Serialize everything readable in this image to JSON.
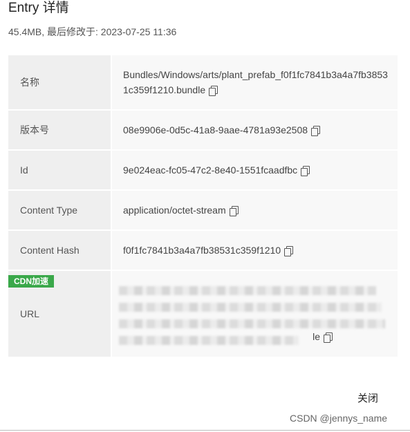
{
  "dialog": {
    "title": "Entry 详情",
    "subtitle": "45.4MB, 最后修改于: 2023-07-25 11:36",
    "close_label": "关闭",
    "watermark": "CSDN @jennys_name"
  },
  "fields": {
    "name": {
      "key": "名称",
      "value": "Bundles/Windows/arts/plant_prefab_f0f1fc7841b3a4a7fb38531c359f1210.bundle"
    },
    "version": {
      "key": "版本号",
      "value": "08e9906e-0d5c-41a8-9aae-4781a93e2508"
    },
    "id": {
      "key": "Id",
      "value": "9e024eac-fc05-47c2-8e40-1551fcaadfbc"
    },
    "content_type": {
      "key": "Content Type",
      "value": "application/octet-stream"
    },
    "content_hash": {
      "key": "Content Hash",
      "value": "f0f1fc7841b3a4a7fb38531c359f1210"
    },
    "url": {
      "key": "URL",
      "badge": "CDN加速",
      "value_tail": "le"
    }
  },
  "icons": {
    "copy": "copy-icon"
  },
  "colors": {
    "badge": "#3aa84a",
    "key_bg": "#efefef",
    "val_bg": "#f8f8f8"
  }
}
